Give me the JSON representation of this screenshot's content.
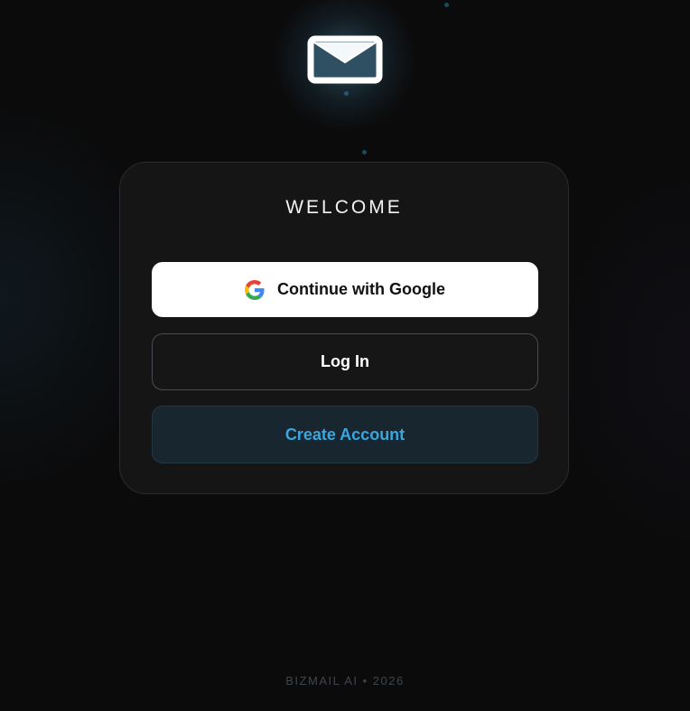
{
  "welcome": {
    "title": "WELCOME"
  },
  "buttons": {
    "google_label": "Continue with Google",
    "login_label": "Log In",
    "create_label": "Create Account"
  },
  "footer": {
    "text": "BIZMAIL AI • 2026"
  },
  "icons": {
    "logo": "envelope-icon",
    "google": "google-icon"
  },
  "colors": {
    "background": "#0b0b0c",
    "card": "#151516",
    "accent": "#3aa6e0",
    "google_button": "#ffffff"
  }
}
